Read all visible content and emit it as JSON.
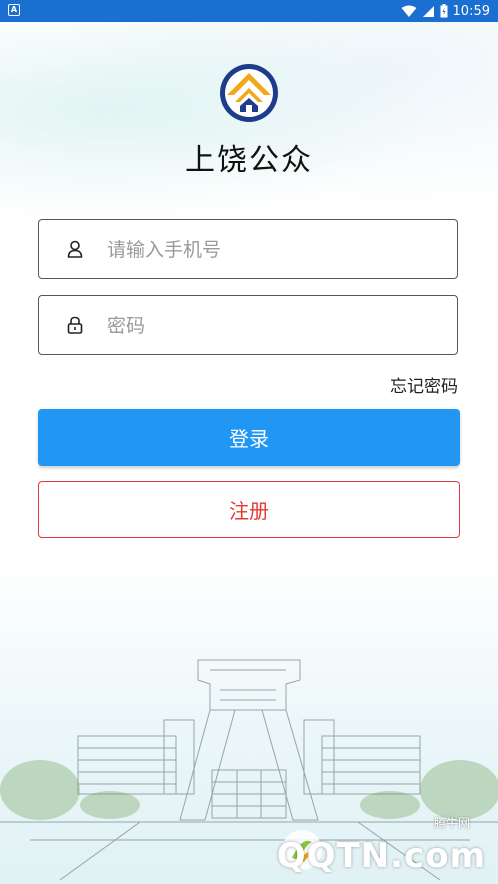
{
  "status_bar": {
    "time": "10:59",
    "left_icon": "A",
    "icons": [
      "wifi-icon",
      "signal-icon",
      "battery-icon"
    ]
  },
  "app": {
    "title": "上饶公众",
    "logo_icon": "house-logo-icon"
  },
  "login_form": {
    "phone_placeholder": "请输入手机号",
    "phone_value": "",
    "password_placeholder": "密码",
    "password_value": "",
    "phone_icon": "user-icon",
    "password_icon": "lock-icon",
    "forgot_label": "忘记密码",
    "login_label": "登录",
    "register_label": "注册"
  },
  "colors": {
    "status_bar": "#1b6fd1",
    "primary": "#2196f3",
    "register_red": "#e53935"
  },
  "watermark": {
    "small_text": "腾牛网",
    "big_text": "QQTN.com"
  }
}
